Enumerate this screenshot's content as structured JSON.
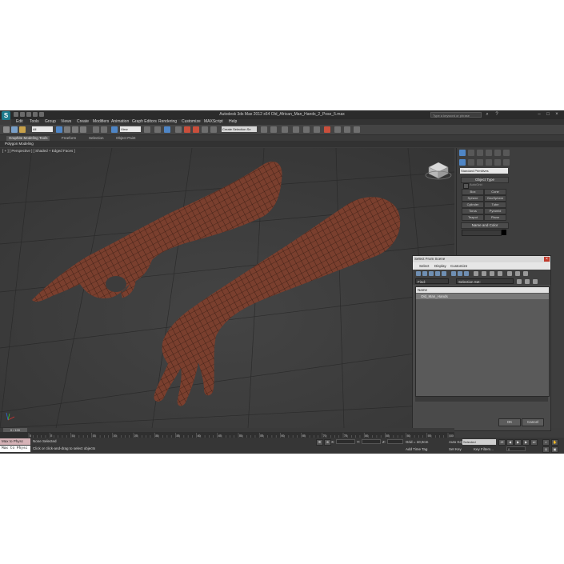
{
  "window": {
    "title": "Autodesk 3ds Max 2012 x64     Old_African_Man_Hands_2_Pose_5.max",
    "search_placeholder": "Type a keyword or phrase",
    "logo_glyph": "S"
  },
  "menu": [
    "Edit",
    "Tools",
    "Group",
    "Views",
    "Create",
    "Modifiers",
    "Animation",
    "Graph Editors",
    "Rendering",
    "Customize",
    "MAXScript",
    "Help"
  ],
  "toolbar": {
    "selection_filter": "All",
    "reference_coord": "View",
    "named_selection": "Create Selection Se"
  },
  "ribbon": {
    "tabs": [
      "Graphite Modeling Tools",
      "Freeform",
      "Selection",
      "Object Paint"
    ],
    "sub_label": "Polygon Modeling"
  },
  "viewport": {
    "label": "[ + ] [ Perspective ] [ Shaded + Edged Faces ]",
    "skin_color": "#7a3f2e",
    "wire_color": "#1e0f0a"
  },
  "command_panel": {
    "category": "Standard Primitives",
    "object_type_title": "Object Type",
    "autogrid": "AutoGrid",
    "primitives": [
      "Box",
      "Cone",
      "Sphere",
      "GeoSphere",
      "Cylinder",
      "Tube",
      "Torus",
      "Pyramid",
      "Teapot",
      "Plane"
    ],
    "name_color_title": "Name and Color"
  },
  "dialog": {
    "title": "Select From Scene",
    "menu": [
      "Select",
      "Display",
      "Customize"
    ],
    "find_label": "Find:",
    "selection_set_label": "Selection Set:",
    "column_name": "Name",
    "items": [
      "Old_Man_Hands"
    ],
    "ok": "OK",
    "cancel": "Cancel"
  },
  "timeline": {
    "frame_display": "0 / 100",
    "ticks": [
      "0",
      "5",
      "10",
      "15",
      "20",
      "25",
      "30",
      "35",
      "40",
      "45",
      "50",
      "55",
      "60",
      "65",
      "70",
      "75",
      "80",
      "85",
      "90",
      "95",
      "100"
    ]
  },
  "status": {
    "maxscript_label": "Max to Physc",
    "maxscript_line": "Max to Physc",
    "selection_text": "None Selected",
    "prompt_text": "Click or click-and-drag to select objects",
    "x_label": "X:",
    "y_label": "Y:",
    "z_label": "Z:",
    "grid_text": "Grid = 10,0cm",
    "auto_key": "Auto Key",
    "set_key": "Set Key",
    "key_filters": "Key Filters...",
    "key_mode": "Selected",
    "add_time_tag": "Add Time Tag",
    "frame_value": "0"
  }
}
